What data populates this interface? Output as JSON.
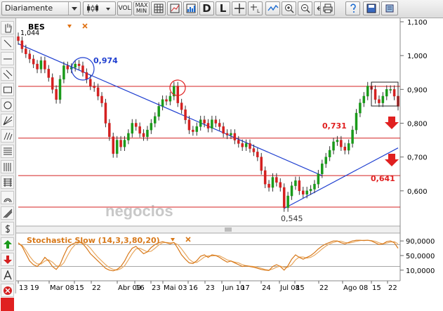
{
  "toolbar": {
    "period_label": "Diariamente",
    "vol_label": "VOL",
    "maxmin_label_1": "MAX",
    "maxmin_label_2": "MIN",
    "d_label": "D",
    "l_label": "L",
    "l2_label": "L"
  },
  "colors": {
    "up": "#1a9a1a",
    "down": "#d42020",
    "trend": "#1f3fd0",
    "support": "#d42020",
    "stoch_k": "#d87818",
    "stoch_d": "#e8a860",
    "accent_blue": "#1f3fd0",
    "accent_red": "#e02020"
  },
  "chart_data": {
    "type": "candlestick",
    "symbol": "BES",
    "last_value_label": "1,044",
    "ylim": [
      0.5,
      1.1
    ],
    "y_ticks": [
      "1,100",
      "1,000",
      "0,900",
      "0,800",
      "0,700",
      "0,600"
    ],
    "x_ticks": [
      "13 19",
      "Mar 08",
      "15",
      "22",
      "Abr 09",
      "16",
      "23",
      "Mai 03",
      "16",
      "23",
      "Jun 10",
      "17",
      "24",
      "Jul 08",
      "15",
      "22",
      "Ago 08",
      "15",
      "22"
    ],
    "closes": [
      1.044,
      1.02,
      1.005,
      0.99,
      0.975,
      0.96,
      0.985,
      0.96,
      0.935,
      0.9,
      0.87,
      0.93,
      0.97,
      0.96,
      0.965,
      0.975,
      0.97,
      0.95,
      0.93,
      0.91,
      0.905,
      0.88,
      0.86,
      0.8,
      0.76,
      0.71,
      0.75,
      0.73,
      0.75,
      0.77,
      0.8,
      0.79,
      0.77,
      0.76,
      0.78,
      0.8,
      0.82,
      0.85,
      0.87,
      0.865,
      0.88,
      0.91,
      0.86,
      0.84,
      0.81,
      0.78,
      0.775,
      0.79,
      0.81,
      0.8,
      0.785,
      0.81,
      0.8,
      0.79,
      0.77,
      0.765,
      0.77,
      0.75,
      0.74,
      0.73,
      0.74,
      0.725,
      0.715,
      0.7,
      0.66,
      0.62,
      0.61,
      0.64,
      0.625,
      0.61,
      0.55,
      0.585,
      0.615,
      0.63,
      0.6,
      0.59,
      0.6,
      0.605,
      0.62,
      0.65,
      0.68,
      0.7,
      0.72,
      0.745,
      0.75,
      0.73,
      0.72,
      0.74,
      0.78,
      0.83,
      0.86,
      0.88,
      0.91,
      0.9,
      0.87,
      0.86,
      0.88,
      0.9,
      0.9,
      0.88,
      0.85
    ],
    "trendlines": [
      {
        "from": [
          0,
          1.035
        ],
        "to": [
          80,
          0.645
        ]
      },
      {
        "from": [
          70,
          0.548
        ],
        "to": [
          100,
          0.727
        ]
      }
    ],
    "horizontal_levels": [
      0.909,
      0.756,
      0.645,
      0.552
    ],
    "price_annotations": [
      {
        "label": "0,974",
        "value": 0.974,
        "color": "blue"
      },
      {
        "label": "0,731",
        "value": 0.731,
        "color": "red"
      },
      {
        "label": "0,641",
        "value": 0.641,
        "color": "red"
      },
      {
        "label": "0,545",
        "value": 0.545,
        "color": "black"
      }
    ],
    "watermark": "negocios",
    "stochastic": {
      "title": "Stochastic Slow (14,3,3,80,20)",
      "y_ticks": [
        "90,0000",
        "50,0000",
        "10,0000"
      ],
      "ylim": [
        0,
        100
      ],
      "levels": [
        80,
        20
      ],
      "k": [
        85,
        75,
        55,
        35,
        25,
        20,
        30,
        45,
        35,
        20,
        12,
        25,
        50,
        72,
        80,
        85,
        88,
        82,
        70,
        55,
        45,
        35,
        25,
        15,
        10,
        8,
        12,
        20,
        35,
        55,
        70,
        75,
        65,
        55,
        60,
        72,
        80,
        85,
        88,
        85,
        82,
        86,
        70,
        52,
        40,
        30,
        28,
        36,
        48,
        52,
        45,
        52,
        50,
        45,
        38,
        32,
        35,
        30,
        25,
        20,
        22,
        20,
        18,
        15,
        12,
        10,
        9,
        20,
        25,
        20,
        10,
        22,
        40,
        52,
        45,
        40,
        45,
        50,
        58,
        68,
        76,
        82,
        86,
        90,
        90,
        85,
        82,
        86,
        90,
        92,
        92,
        91,
        92,
        90,
        85,
        80,
        82,
        88,
        90,
        85,
        70
      ],
      "d": [
        83,
        78,
        65,
        48,
        35,
        27,
        27,
        35,
        38,
        32,
        22,
        20,
        30,
        50,
        68,
        80,
        85,
        85,
        80,
        70,
        57,
        45,
        35,
        25,
        17,
        12,
        10,
        14,
        22,
        38,
        55,
        68,
        70,
        65,
        60,
        62,
        70,
        79,
        85,
        86,
        85,
        85,
        80,
        68,
        54,
        40,
        32,
        31,
        38,
        46,
        49,
        49,
        50,
        49,
        44,
        38,
        35,
        32,
        30,
        25,
        22,
        21,
        20,
        18,
        15,
        12,
        10,
        13,
        18,
        21,
        18,
        18,
        25,
        38,
        46,
        46,
        43,
        45,
        51,
        59,
        68,
        76,
        82,
        86,
        89,
        89,
        86,
        84,
        86,
        89,
        91,
        92,
        92,
        91,
        89,
        85,
        82,
        84,
        87,
        88,
        82
      ]
    }
  }
}
